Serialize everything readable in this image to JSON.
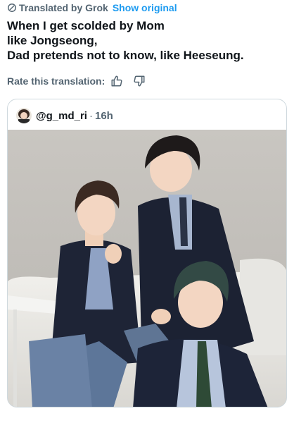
{
  "translation": {
    "label": "Translated by Grok",
    "show_original": "Show original",
    "icon": "translate-globe-icon"
  },
  "tweet": {
    "lines": [
      "When I get scolded by Mom",
      "like Jongseong,",
      "Dad pretends not to know, like Heeseung."
    ]
  },
  "rating": {
    "label": "Rate this translation:",
    "icons": [
      "thumbs-up-icon",
      "thumbs-down-icon"
    ]
  },
  "quote": {
    "handle": "@g_md_ri",
    "separator": "·",
    "time": "16h"
  },
  "colors": {
    "text": "#0f1419",
    "secondary": "#536471",
    "link": "#1d9bf0",
    "border": "#cfd9de"
  }
}
